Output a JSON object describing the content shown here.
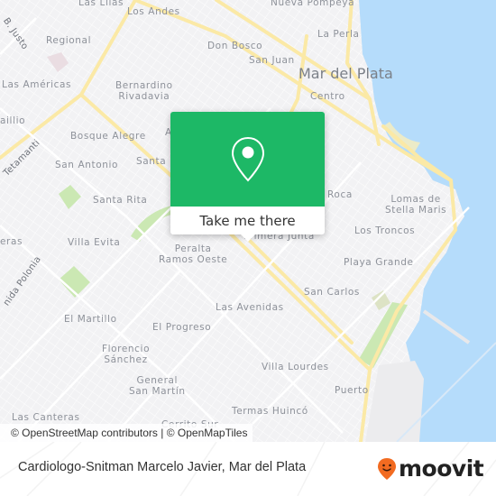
{
  "map": {
    "city_label": "Mar del Plata",
    "neighborhoods": [
      {
        "id": "las-lilas",
        "name": "Las Lilas"
      },
      {
        "id": "los-andes",
        "name": "Los Andes"
      },
      {
        "id": "nueva-pompeya",
        "name": "Nueva Pompeya"
      },
      {
        "id": "regional",
        "name": "Regional"
      },
      {
        "id": "don-bosco",
        "name": "Don Bosco"
      },
      {
        "id": "la-perla",
        "name": "La Perla"
      },
      {
        "id": "san-juan",
        "name": "San Juan"
      },
      {
        "id": "las-americas",
        "name": "Las Américas"
      },
      {
        "id": "bernardino-rivadavia",
        "name": "Bernardino\nRivadavia"
      },
      {
        "id": "centro",
        "name": "Centro"
      },
      {
        "id": "caillio",
        "name": "aillio"
      },
      {
        "id": "bosque-alegre",
        "name": "Bosque Alegre"
      },
      {
        "id": "a-label",
        "name": "A"
      },
      {
        "id": "san-antonio",
        "name": "San Antonio"
      },
      {
        "id": "santa-m",
        "name": "Santa M"
      },
      {
        "id": "roca",
        "name": "Roca"
      },
      {
        "id": "lomas-stella-maris",
        "name": "Lomas de\nStella Maris"
      },
      {
        "id": "santa-rita",
        "name": "Santa Rita"
      },
      {
        "id": "primera-junta",
        "name": "Primera Junta"
      },
      {
        "id": "los-troncos",
        "name": "Los Troncos"
      },
      {
        "id": "eras",
        "name": "eras"
      },
      {
        "id": "villa-evita",
        "name": "Villa Evita"
      },
      {
        "id": "peralta-ramos-oeste",
        "name": "Peralta\nRamos Oeste"
      },
      {
        "id": "playa-grande",
        "name": "Playa Grande"
      },
      {
        "id": "san-carlos",
        "name": "San Carlos"
      },
      {
        "id": "las-avenidas",
        "name": "Las Avenidas"
      },
      {
        "id": "el-martillo",
        "name": "El Martillo"
      },
      {
        "id": "el-progreso",
        "name": "El Progreso"
      },
      {
        "id": "florencio-sanchez",
        "name": "Florencio\nSánchez"
      },
      {
        "id": "general-san-martin",
        "name": "General\nSan Martín"
      },
      {
        "id": "villa-lourdes",
        "name": "Villa Lourdes"
      },
      {
        "id": "puerto",
        "name": "Puerto"
      },
      {
        "id": "termas-huinco",
        "name": "Termas Huincó"
      },
      {
        "id": "las-canteras",
        "name": "Las Canteras"
      },
      {
        "id": "cerrito-sur",
        "name": "Cerrito Sur"
      }
    ],
    "roads": [
      {
        "id": "jb-justo",
        "name": "B. Justo"
      },
      {
        "id": "tetamanti",
        "name": "Tetamanti"
      },
      {
        "id": "avenida-polonia",
        "name": "nida Polonia"
      }
    ],
    "attribution": "© OpenStreetMap contributors | © OpenMapTiles",
    "colors": {
      "land": "#f2f2f4",
      "water": "#b5dcfb",
      "major_road": "#fbe9a6",
      "park": "#cbe8b3",
      "accent": "#1db866"
    }
  },
  "popup": {
    "icon": "map-pin-icon",
    "action_label": "Take me there"
  },
  "footer": {
    "place_title": "Cardiologo-Snitman Marcelo Javier, Mar del Plata",
    "brand": "moovit",
    "brand_icon": "moovit-smiley-pin-icon",
    "brand_color": "#f26b21"
  }
}
